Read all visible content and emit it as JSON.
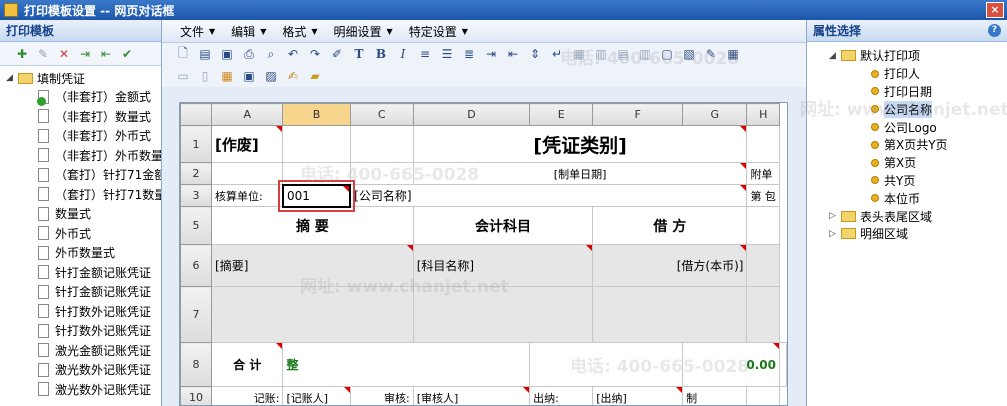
{
  "window": {
    "title": "打印模板设置 -- 网页对话框",
    "close_label": "×"
  },
  "left_panel": {
    "title": "打印模板",
    "root": "填制凭证",
    "items": [
      "（非套打）金额式",
      "（非套打）数量式",
      "（非套打）外币式",
      "（非套打）外币数量",
      "（套打）针打71金额",
      "（套打）针打71数量",
      "数量式",
      "外币式",
      "外币数量式",
      "针打金额记账凭证",
      "针打金额记账凭证",
      "针打数外记账凭证",
      "针打数外记账凭证",
      "激光金额记账凭证",
      "激光数外记账凭证",
      "激光数外记账凭证"
    ]
  },
  "menu": [
    {
      "label": "文件"
    },
    {
      "label": "编辑"
    },
    {
      "label": "格式"
    },
    {
      "label": "明细设置"
    },
    {
      "label": "特定设置"
    }
  ],
  "sheet": {
    "col_headers": [
      "A",
      "B",
      "C",
      "D",
      "E",
      "F",
      "G",
      "H"
    ],
    "row_headers": [
      "1",
      "2",
      "3",
      "5",
      "6",
      "7",
      "8",
      "10"
    ],
    "zuofei": "[作废]",
    "title": "[凭证类别]",
    "date": "[制单日期]",
    "fudan": "附单",
    "di": "第 包",
    "unit_label": "核算单位:",
    "unit_value": "001",
    "company": "[公司名称]",
    "col_summary": "摘  要",
    "col_subject": "会计科目",
    "col_debit": "借  方",
    "summary_field": "[摘要]",
    "subject_field": "[科目名称]",
    "debit_field": "[借方(本币)]",
    "total_label": "合  计",
    "total_zheng": "整",
    "total_value": "0.00",
    "jizhang_label": "记账:",
    "jizhang_field": "[记账人]",
    "shenhe_label": "审核:",
    "shenhe_field": "[审核人]",
    "chuna_label": "出纳:",
    "chuna_field": "[出纳]",
    "last": "制"
  },
  "right_panel": {
    "title": "属性选择",
    "help": "?",
    "default_group": "默认打印项",
    "default_items": [
      "打印人",
      "打印日期",
      "公司名称",
      "公司Logo",
      "第X页共Y页",
      "第X页",
      "共Y页",
      "本位币"
    ],
    "other_groups": [
      "表头表尾区域",
      "明细区域"
    ]
  },
  "watermark": {
    "phone": "电话: 400-665-0028",
    "site": "网址: www.chanjet.net"
  }
}
